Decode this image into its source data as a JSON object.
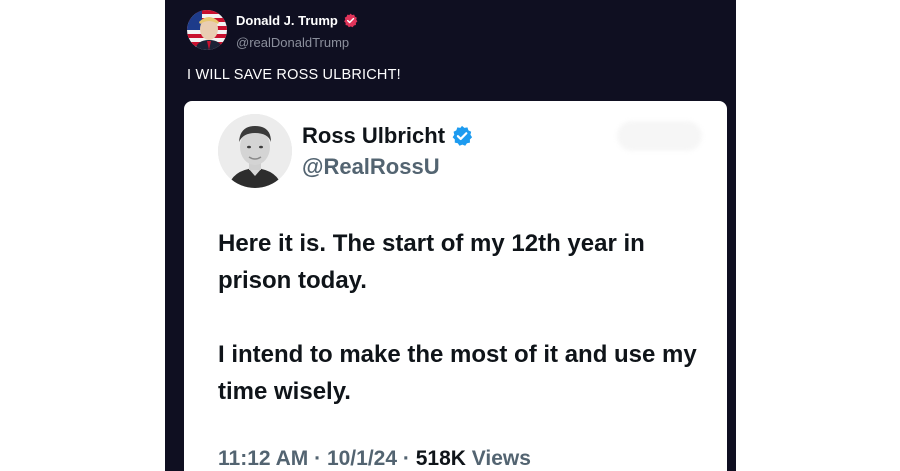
{
  "post": {
    "author_name": "Donald J. Trump",
    "author_handle": "@realDonaldTrump",
    "text": "I WILL SAVE ROSS ULBRICHT!"
  },
  "embed": {
    "name": "Ross Ulbricht",
    "handle": "@RealRossU",
    "paragraphs": [
      "Here it is. The start of my 12th year in prison today.",
      "I intend to make the most of it and use my time wisely."
    ],
    "time": "11:12 AM",
    "date": "10/1/24",
    "views_count": "518K",
    "views_label": "Views",
    "separator": "·"
  },
  "colors": {
    "post_background": "#0f0f21",
    "verified_badge_post": "#e0345a",
    "verified_badge_embed": "#1d9bf0",
    "secondary_text": "#536471"
  },
  "icons": {
    "post_verified": "verified-badge-icon",
    "embed_verified": "verified-badge-icon"
  }
}
